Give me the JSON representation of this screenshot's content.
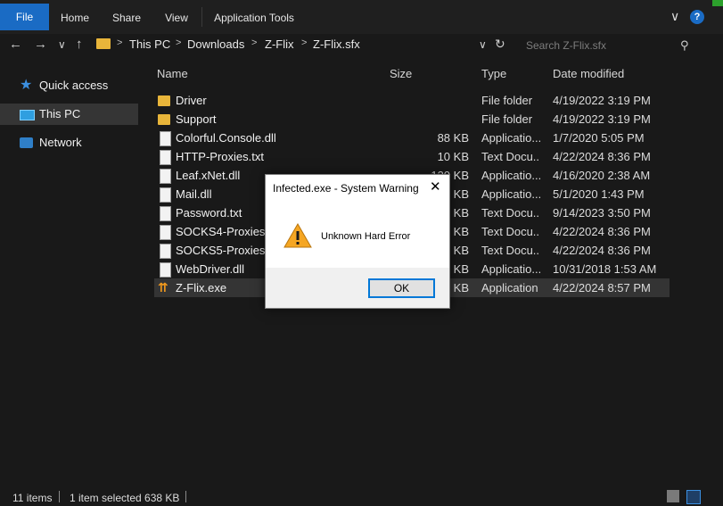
{
  "ribbon": {
    "tabs": [
      "File",
      "Home",
      "Share",
      "View",
      "Application Tools"
    ],
    "minimize_glyph": "∨",
    "help_glyph": "?"
  },
  "address": {
    "back_glyph": "←",
    "forward_glyph": "→",
    "recent_glyph": "∨",
    "up_glyph": "↑",
    "crumbs": [
      "This PC",
      "Downloads",
      "Z-Flix",
      "Z-Flix.sfx"
    ],
    "separator": ">",
    "dropdown_glyph": "∨",
    "refresh_glyph": "↻",
    "search_placeholder": "Search Z-Flix.sfx",
    "search_value": ""
  },
  "nav_pane": {
    "items": [
      "Quick access",
      "This PC",
      "Network"
    ]
  },
  "columns": {
    "name": "Name",
    "size": "Size",
    "type": "Type",
    "date": "Date modified"
  },
  "files": [
    {
      "name": "Driver",
      "size": "",
      "type": "File folder",
      "date": "4/19/2022 3:19 PM",
      "icon": "folder-icon"
    },
    {
      "name": "Support",
      "size": "",
      "type": "File folder",
      "date": "4/19/2022 3:19 PM",
      "icon": "folder-icon"
    },
    {
      "name": "Colorful.Console.dll",
      "size": "88 KB",
      "type": "Applicatio...",
      "date": "1/7/2020 5:05 PM",
      "icon": "dll-icon"
    },
    {
      "name": "HTTP-Proxies.txt",
      "size": "10 KB",
      "type": "Text Docu...",
      "date": "4/22/2024 8:36 PM",
      "icon": "text-file-icon"
    },
    {
      "name": "Leaf.xNet.dll",
      "size": "130 KB",
      "type": "Applicatio...",
      "date": "4/16/2020 2:38 AM",
      "icon": "dll-icon"
    },
    {
      "name": "Mail.dll",
      "size": "KB",
      "type": "Applicatio...",
      "date": "5/1/2020 1:43 PM",
      "icon": "dll-icon"
    },
    {
      "name": "Password.txt",
      "size": "KB",
      "type": "Text Docu...",
      "date": "9/14/2023 3:50 PM",
      "icon": "text-file-icon"
    },
    {
      "name": "SOCKS4-Proxies.txt",
      "size": "KB",
      "type": "Text Docu...",
      "date": "4/22/2024 8:36 PM",
      "icon": "text-file-icon"
    },
    {
      "name": "SOCKS5-Proxies.txt",
      "size": "9 KB",
      "type": "Text Docu...",
      "date": "4/22/2024 8:36 PM",
      "icon": "text-file-icon"
    },
    {
      "name": "WebDriver.dll",
      "size": "2 KB",
      "type": "Applicatio...",
      "date": "10/31/2018 1:53 AM",
      "icon": "dll-icon"
    },
    {
      "name": "Z-Flix.exe",
      "size": "9 KB",
      "type": "Application",
      "date": "4/22/2024 8:57 PM",
      "icon": "exe-icon",
      "selected": true
    }
  ],
  "dialog": {
    "title": "Infected.exe - System Warning",
    "close_glyph": "✕",
    "message": "Unknown Hard Error",
    "ok_label": "OK"
  },
  "status": {
    "items_count": "11 items",
    "selection": "1 item selected  638 KB"
  },
  "colors": {
    "accent": "#1a6bc4",
    "background": "#191919",
    "folder": "#e8b53a",
    "warning": "#f5a623"
  }
}
